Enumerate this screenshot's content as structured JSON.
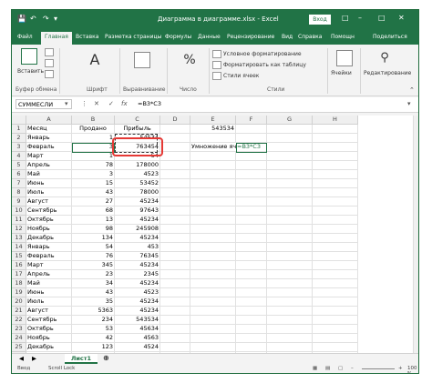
{
  "window": {
    "title": "Диаграмма в диаграмме.xlsx - Excel",
    "login_button": "Вход"
  },
  "colors": {
    "accent": "#217346",
    "highlight": "#e53935"
  },
  "ribbon_tabs": [
    "Файл",
    "Главная",
    "Вставка",
    "Разметка страницы",
    "Формулы",
    "Данные",
    "Рецензирование",
    "Вид",
    "Справка",
    "Помощн",
    "Поделиться"
  ],
  "ribbon": {
    "paste_label": "Вставить",
    "clipboard_label": "Буфер обмена",
    "font_label": "Шрифт",
    "alignment_label": "Выравнивание",
    "number_label": "Число",
    "cond_format": "Условное форматирование",
    "format_table": "Форматировать как таблицу",
    "cell_styles": "Стили ячеек",
    "styles_label": "Стили",
    "cells_label": "Ячейки",
    "editing_label": "Редактирование"
  },
  "formula_bar": {
    "name_box": "СУММЕСЛИ",
    "formula": "=B3*C3"
  },
  "columns": [
    "A",
    "B",
    "C",
    "D",
    "E",
    "F",
    "G",
    "H"
  ],
  "header_row": [
    "Месяц",
    "Продано",
    "Прибыль"
  ],
  "rows": [
    [
      "Январь",
      "1",
      "54534"
    ],
    [
      "Февраль",
      "3",
      "763454"
    ],
    [
      "Март",
      "1",
      "54"
    ],
    [
      "Апрель",
      "78",
      "178000"
    ],
    [
      "Май",
      "3",
      "4523"
    ],
    [
      "Июнь",
      "15",
      "53452"
    ],
    [
      "Июль",
      "43",
      "78000"
    ],
    [
      "Август",
      "27",
      "45234"
    ],
    [
      "Сентябрь",
      "68",
      "97643"
    ],
    [
      "Октябрь",
      "13",
      "45234"
    ],
    [
      "Ноябрь",
      "98",
      "245908"
    ],
    [
      "Декабрь",
      "134",
      "45234"
    ],
    [
      "Январь",
      "54",
      "453"
    ],
    [
      "Февраль",
      "76",
      "76345"
    ],
    [
      "Март",
      "345",
      "45234"
    ],
    [
      "Апрель",
      "23",
      "2345"
    ],
    [
      "Май",
      "34",
      "45234"
    ],
    [
      "Июнь",
      "43",
      "4523"
    ],
    [
      "Июль",
      "35",
      "45234"
    ],
    [
      "Август",
      "5363",
      "45234"
    ],
    [
      "Сентябрь",
      "234",
      "543534"
    ],
    [
      "Октябрь",
      "53",
      "45634"
    ],
    [
      "Ноябрь",
      "42",
      "4563"
    ],
    [
      "Декабрь",
      "123",
      "4524"
    ]
  ],
  "e1_value": "543534",
  "e3_label": "Умножение ячеек",
  "f3_formula": "=B3*C3",
  "sheet_tab": "Лист1",
  "status": {
    "mode": "Ввод",
    "scroll": "Scroll Lock",
    "zoom": "100 %"
  }
}
